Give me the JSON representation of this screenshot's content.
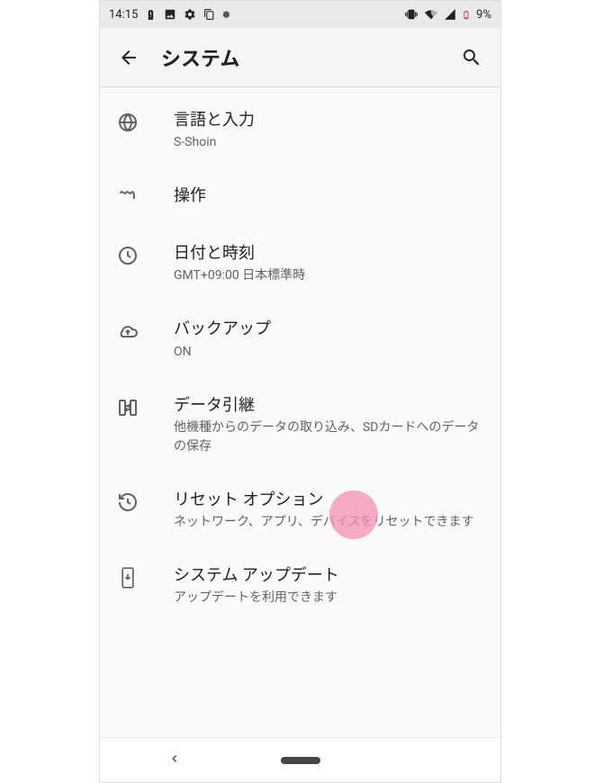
{
  "status": {
    "time": "14:15",
    "battery_pct": "9%"
  },
  "header": {
    "title": "システム"
  },
  "items": [
    {
      "id": "language",
      "title": "言語と入力",
      "sub": "S-Shoin"
    },
    {
      "id": "gestures",
      "title": "操作",
      "sub": ""
    },
    {
      "id": "datetime",
      "title": "日付と時刻",
      "sub": "GMT+09:00 日本標準時"
    },
    {
      "id": "backup",
      "title": "バックアップ",
      "sub": "ON"
    },
    {
      "id": "datatransfer",
      "title": "データ引継",
      "sub": "他機種からのデータの取り込み、SDカードへのデータの保存"
    },
    {
      "id": "reset",
      "title": "リセット オプション",
      "sub": "ネットワーク、アプリ、デバイスをリセットできます"
    },
    {
      "id": "update",
      "title": "システム アップデート",
      "sub": "アップデートを利用できます"
    }
  ]
}
